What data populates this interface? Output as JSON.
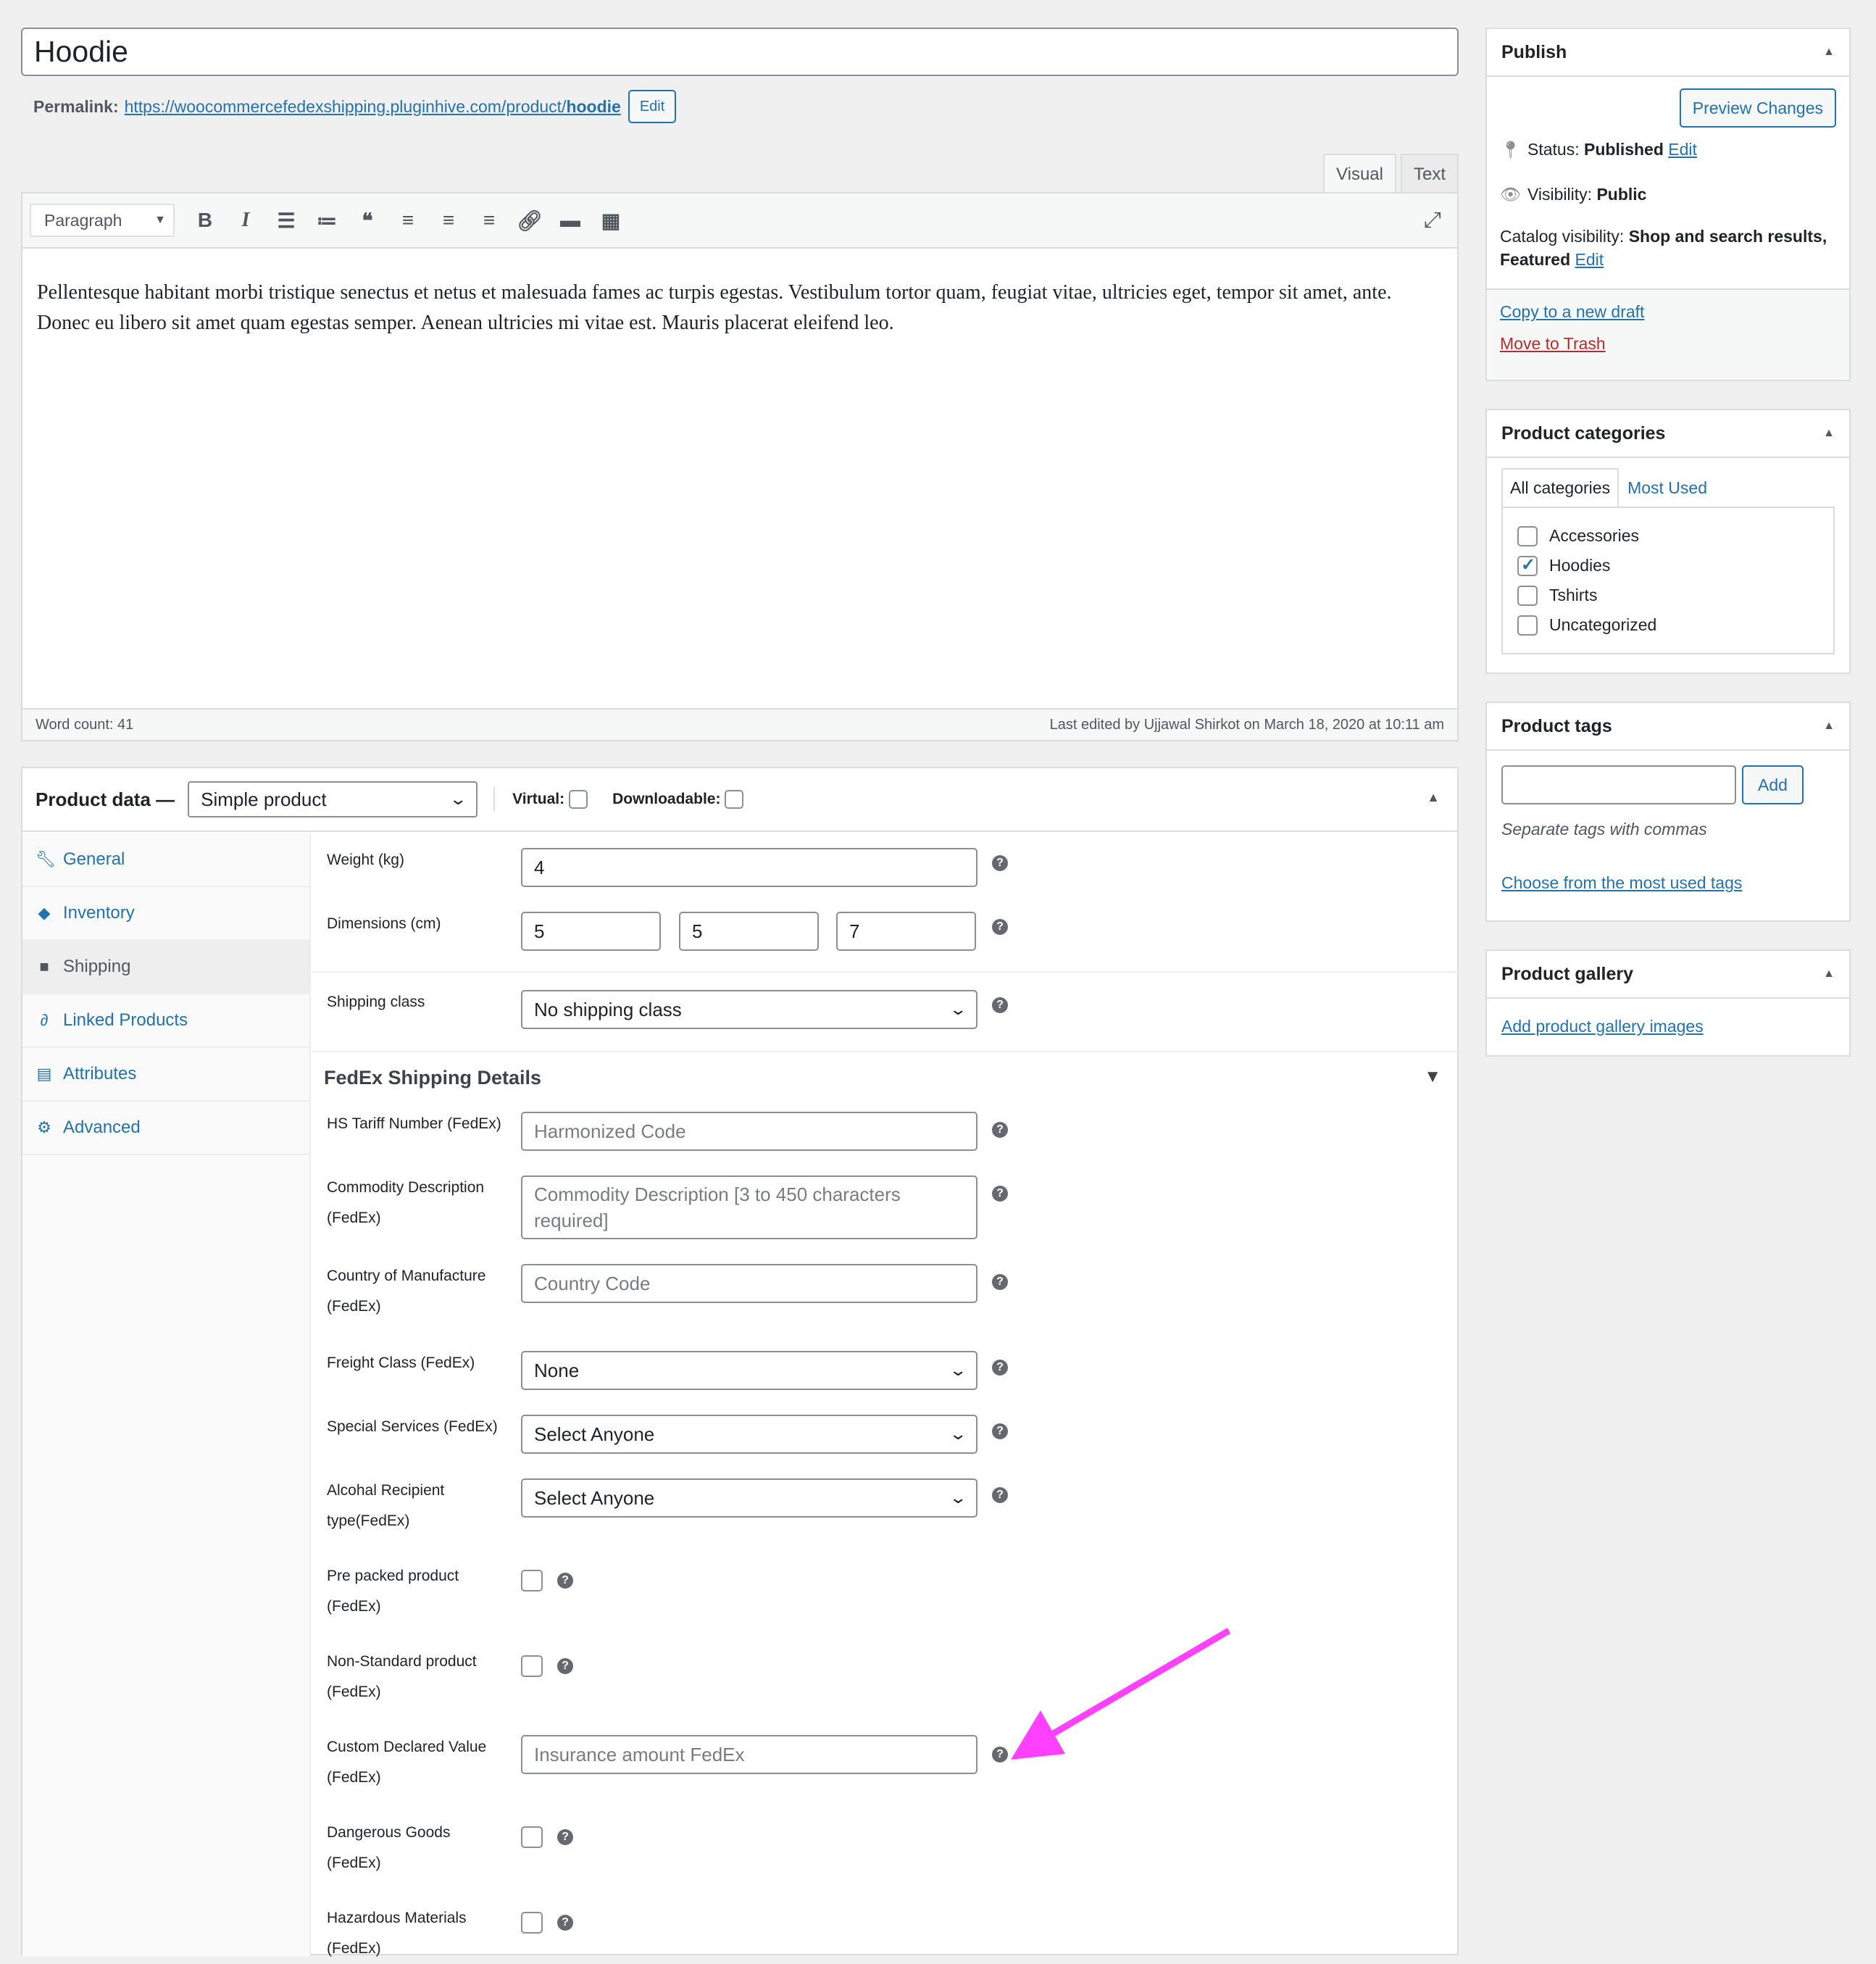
{
  "title": {
    "value": "Hoodie"
  },
  "permalink": {
    "label": "Permalink:",
    "url_base": "https://woocommercefedexshipping.pluginhive.com/product/",
    "slug": "hoodie",
    "edit_label": "Edit"
  },
  "editor": {
    "tabs": [
      {
        "label": "Visual",
        "active": true
      },
      {
        "label": "Text",
        "active": false
      }
    ],
    "format": "Paragraph",
    "toolbar_icons": [
      "bold-icon",
      "italic-icon",
      "bullet-list-icon",
      "numbered-list-icon",
      "blockquote-icon",
      "align-left-icon",
      "align-center-icon",
      "align-right-icon",
      "link-icon",
      "read-more-icon",
      "toolbar-toggle-icon"
    ],
    "body": "Pellentesque habitant morbi tristique senectus et netus et malesuada fames ac turpis egestas. Vestibulum tortor quam, feugiat vitae, ultricies eget, tempor sit amet, ante. Donec eu libero sit amet quam egestas semper. Aenean ultricies mi vitae est. Mauris placerat eleifend leo.",
    "word_count": "Word count: 41",
    "last_edited": "Last edited by Ujjawal Shirkot on March 18, 2020 at 10:11 am"
  },
  "product_data": {
    "title": "Product data —",
    "type": "Simple product",
    "virtual_label": "Virtual:",
    "downloadable_label": "Downloadable:",
    "tabs": [
      {
        "label": "General",
        "icon": "wrench-icon"
      },
      {
        "label": "Inventory",
        "icon": "tag-icon"
      },
      {
        "label": "Shipping",
        "icon": "truck-icon",
        "active": true
      },
      {
        "label": "Linked Products",
        "icon": "link-icon"
      },
      {
        "label": "Attributes",
        "icon": "list-icon"
      },
      {
        "label": "Advanced",
        "icon": "gear-icon"
      }
    ],
    "shipping": {
      "weight_label": "Weight (kg)",
      "weight": "4",
      "dimensions_label": "Dimensions (cm)",
      "length": "5",
      "width": "5",
      "height": "7",
      "class_label": "Shipping class",
      "class_value": "No shipping class"
    },
    "fedex": {
      "title": "FedEx Shipping Details",
      "hs_label": "HS Tariff Number (FedEx)",
      "hs_placeholder": "Harmonized Code",
      "commodity_label": "Commodity Description (FedEx)",
      "commodity_placeholder": "Commodity Description [3 to 450 characters required]",
      "country_label": "Country of Manufacture (FedEx)",
      "country_placeholder": "Country Code",
      "freight_label": "Freight Class (FedEx)",
      "freight_value": "None",
      "special_label": "Special Services (FedEx)",
      "special_value": "Select Anyone",
      "alcohol_label": "Alcohal Recipient type(FedEx)",
      "alcohol_value": "Select Anyone",
      "prepacked_label": "Pre packed product (FedEx)",
      "nonstandard_label": "Non-Standard product (FedEx)",
      "declared_label": "Custom Declared Value (FedEx)",
      "declared_placeholder": "Insurance amount FedEx",
      "dangerous_label": "Dangerous Goods (FedEx)",
      "hazardous_label": "Hazardous Materials (FedEx)"
    }
  },
  "publish": {
    "title": "Publish",
    "preview_label": "Preview Changes",
    "status_label": "Status:",
    "status_value": "Published",
    "visibility_label": "Visibility:",
    "visibility_value": "Public",
    "catalog_label": "Catalog visibility:",
    "catalog_value": "Shop and search results, Featured",
    "edit_label": "Edit",
    "copy_draft": "Copy to a new draft",
    "trash": "Move to Trash"
  },
  "categories": {
    "title": "Product categories",
    "tab_all": "All categories",
    "tab_most": "Most Used",
    "items": [
      {
        "label": "Accessories",
        "checked": false
      },
      {
        "label": "Hoodies",
        "checked": true
      },
      {
        "label": "Tshirts",
        "checked": false
      },
      {
        "label": "Uncategorized",
        "checked": false
      }
    ]
  },
  "tags": {
    "title": "Product tags",
    "input_value": "",
    "add_label": "Add",
    "hint": "Separate tags with commas",
    "choose_link": "Choose from the most used tags"
  },
  "gallery": {
    "title": "Product gallery",
    "add_link": "Add product gallery images"
  },
  "colors": {
    "accent": "#2271b1",
    "trash": "#b32d2e",
    "annotation_arrow": "#ff40ff"
  }
}
